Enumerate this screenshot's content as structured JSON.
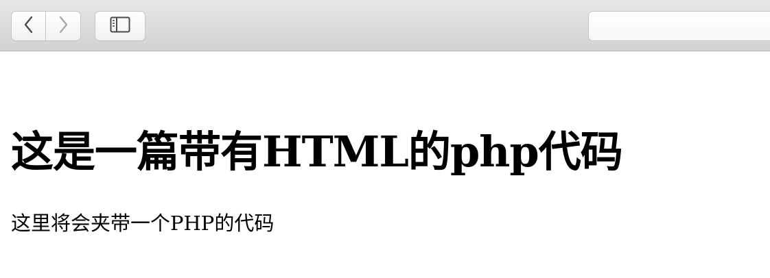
{
  "browser": {
    "toolbar": {
      "back_icon": "chevron-left-icon",
      "forward_icon": "chevron-right-icon",
      "sidebar_icon": "sidebar-icon",
      "address_value": ""
    }
  },
  "page": {
    "heading": "这是一篇带有HTML的php代码",
    "paragraph": "这里将会夹带一个PHP的代码"
  },
  "colors": {
    "toolbar_top": "#e8e8e8",
    "toolbar_bottom": "#d2d2d2",
    "text": "#000000",
    "background": "#ffffff"
  }
}
